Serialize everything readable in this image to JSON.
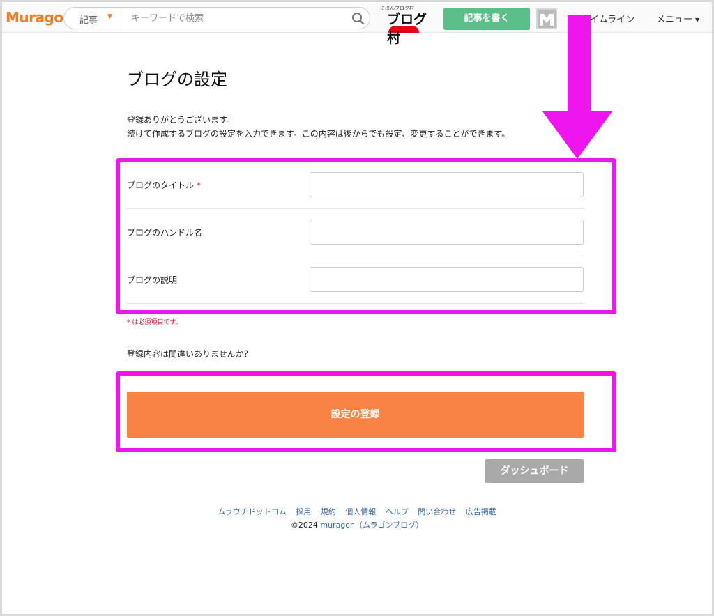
{
  "header": {
    "logo": "Muragon",
    "search": {
      "category": "記事",
      "placeholder": "キーワードで検索"
    },
    "blogmura": {
      "small": "にほんブログ村",
      "text": "ブログ村"
    },
    "write_button": "記事を書く",
    "nav": {
      "timeline": "タイムライン",
      "menu": "メニュー"
    },
    "colors": {
      "logo": "#f47b20",
      "write_button": "#5cbf8a"
    }
  },
  "main": {
    "title": "ブログの設定",
    "intro": [
      "登録ありがとうございます。",
      "続けて作成するブログの設定を入力できます。この内容は後からでも設定、変更することができます。"
    ],
    "fields": [
      {
        "label": "ブログのタイトル",
        "required_mark": "*",
        "value": ""
      },
      {
        "label": "ブログのハンドル名",
        "value": ""
      },
      {
        "label": "ブログの説明",
        "value": ""
      }
    ],
    "required_note": "* は必須項目です。",
    "confirm_text": "登録内容は間違いありませんか？",
    "submit_button": "設定の登録",
    "dashboard_button": "ダッシュボード",
    "colors": {
      "submit": "#f98245",
      "dashboard": "#a9a9a9",
      "highlight": "#ee15ee"
    }
  },
  "footer": {
    "links": [
      "ムラウチドットコム",
      "採用",
      "規約",
      "個人情報",
      "ヘルプ",
      "問い合わせ",
      "広告掲載"
    ],
    "copyright_prefix": "©2024 ",
    "copyright_link": "muragon（ムラゴンブログ）"
  }
}
